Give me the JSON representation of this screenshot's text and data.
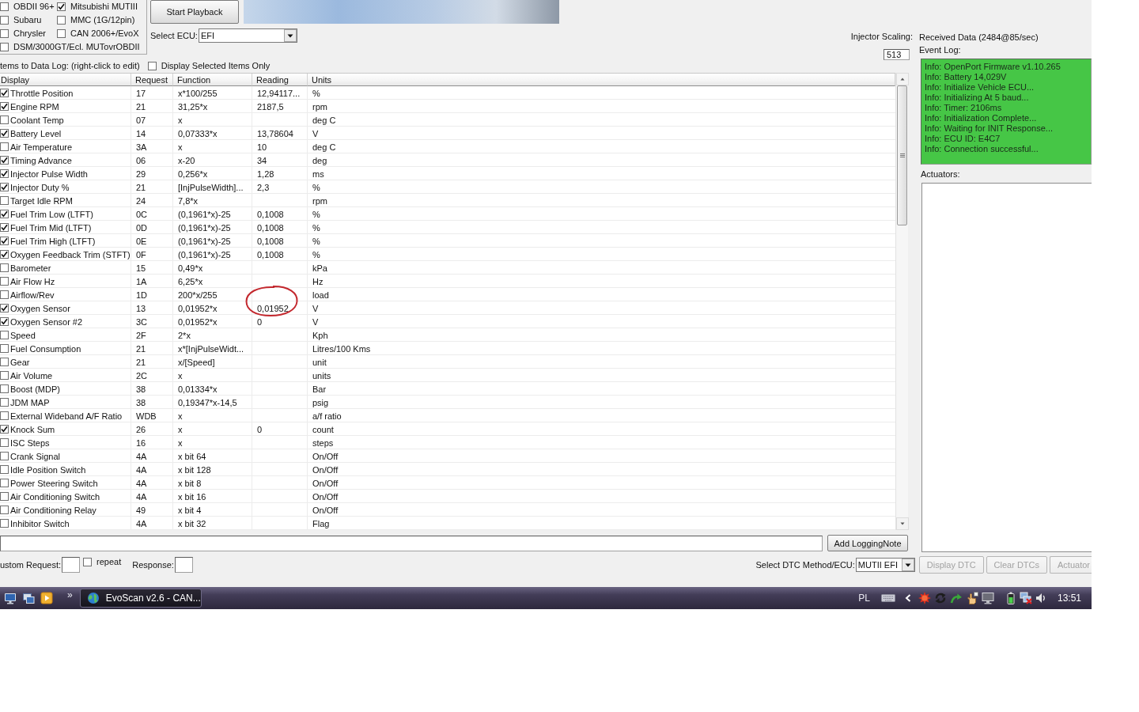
{
  "protocols": [
    {
      "label": "OBDII 96+",
      "checked": false
    },
    {
      "label": "Mitsubishi MUTIII",
      "checked": true
    },
    {
      "label": "Subaru",
      "checked": false
    },
    {
      "label": "MMC (1G/12pin)",
      "checked": false
    },
    {
      "label": "Chrysler",
      "checked": false
    },
    {
      "label": "CAN 2006+/EvoX",
      "checked": false
    },
    {
      "label": "DSM/3000GT/Ecl. MUTovrOBDII",
      "checked": false
    }
  ],
  "playback_button": "Start Playback",
  "ecu_select": {
    "label": "Select ECU:",
    "value": "EFI"
  },
  "injector_scaling": {
    "label": "Injector Scaling:",
    "value": "513"
  },
  "received_data": "Received Data (2484@85/sec)",
  "event_log": {
    "label": "Event Log:",
    "lines": [
      "Info: OpenPort Firmware v1.10.265",
      "Info: Battery 14,029V",
      "Info: Initialize Vehicle ECU...",
      "Info: Initializing At 5 baud...",
      "Info: Timer: 2106ms",
      "Info: Initialization Complete...",
      "Info: Waiting for INIT Response...",
      "Info: ECU ID: E4C7",
      "Info: Connection successful..."
    ]
  },
  "data_log": {
    "label": "tems to Data Log: (right-click to edit)",
    "display_selected_only": {
      "label": "Display Selected Items Only",
      "checked": false
    }
  },
  "table": {
    "columns": [
      "Display",
      "Request",
      "Function",
      "Reading",
      "Units"
    ],
    "rows": [
      {
        "checked": true,
        "display": "Throttle Position",
        "request": "17",
        "function": "x*100/255",
        "reading": "12,94117...",
        "units": "%",
        "circled": false
      },
      {
        "checked": true,
        "display": "Engine RPM",
        "request": "21",
        "function": "31,25*x",
        "reading": "2187,5",
        "units": "rpm",
        "circled": false
      },
      {
        "checked": false,
        "display": "Coolant Temp",
        "request": "07",
        "function": "x",
        "units": "deg C",
        "circled": false
      },
      {
        "checked": true,
        "display": "Battery Level",
        "request": "14",
        "function": "0,07333*x",
        "reading": "13,78604",
        "units": "V",
        "circled": false
      },
      {
        "checked": false,
        "display": "Air Temperature",
        "request": "3A",
        "function": "x",
        "reading": "10",
        "units": "deg C",
        "circled": false
      },
      {
        "checked": true,
        "display": "Timing Advance",
        "request": "06",
        "function": "x-20",
        "reading": "34",
        "units": "deg",
        "circled": false
      },
      {
        "checked": true,
        "display": "Injector Pulse Width",
        "request": "29",
        "function": "0,256*x",
        "reading": "1,28",
        "units": "ms",
        "circled": false
      },
      {
        "checked": true,
        "display": "Injector Duty %",
        "request": "21",
        "function": "[InjPulseWidth]...",
        "reading": "2,3",
        "units": "%",
        "circled": false
      },
      {
        "checked": false,
        "display": "Target Idle RPM",
        "request": "24",
        "function": "7,8*x",
        "units": "rpm",
        "circled": false
      },
      {
        "checked": true,
        "display": "Fuel Trim Low (LTFT)",
        "request": "0C",
        "function": "(0,1961*x)-25",
        "reading": "0,1008",
        "units": "%",
        "circled": false
      },
      {
        "checked": true,
        "display": "Fuel Trim Mid (LTFT)",
        "request": "0D",
        "function": "(0,1961*x)-25",
        "reading": "0,1008",
        "units": "%",
        "circled": false
      },
      {
        "checked": true,
        "display": "Fuel Trim High (LTFT)",
        "request": "0E",
        "function": "(0,1961*x)-25",
        "reading": "0,1008",
        "units": "%",
        "circled": false
      },
      {
        "checked": true,
        "display": "Oxygen Feedback Trim (STFT)",
        "request": "0F",
        "function": "(0,1961*x)-25",
        "reading": "0,1008",
        "units": "%",
        "circled": false
      },
      {
        "checked": false,
        "display": "Barometer",
        "request": "15",
        "function": "0,49*x",
        "units": "kPa",
        "circled": false
      },
      {
        "checked": false,
        "display": "Air Flow Hz",
        "request": "1A",
        "function": "6,25*x",
        "units": "Hz",
        "circled": false
      },
      {
        "checked": false,
        "display": "Airflow/Rev",
        "request": "1D",
        "function": "200*x/255",
        "units": "load",
        "circled": false
      },
      {
        "checked": true,
        "display": "Oxygen Sensor",
        "request": "13",
        "function": "0,01952*x",
        "reading": "0,01952",
        "units": "V",
        "circled": true
      },
      {
        "checked": true,
        "display": "Oxygen Sensor #2",
        "request": "3C",
        "function": "0,01952*x",
        "reading": "0",
        "units": "V",
        "circled": false
      },
      {
        "checked": false,
        "display": "Speed",
        "request": "2F",
        "function": "2*x",
        "units": "Kph",
        "circled": false
      },
      {
        "checked": false,
        "display": "Fuel Consumption",
        "request": "21",
        "function": "x*[InjPulseWidt...",
        "units": "Litres/100 Kms",
        "circled": false
      },
      {
        "checked": false,
        "display": "Gear",
        "request": "21",
        "function": "x/[Speed]",
        "units": "unit",
        "circled": false
      },
      {
        "checked": false,
        "display": "Air Volume",
        "request": "2C",
        "function": "x",
        "units": "units",
        "circled": false
      },
      {
        "checked": false,
        "display": "Boost (MDP)",
        "request": "38",
        "function": "0,01334*x",
        "units": "Bar",
        "circled": false
      },
      {
        "checked": false,
        "display": "JDM MAP",
        "request": "38",
        "function": "0,19347*x-14,5",
        "units": "psig",
        "circled": false
      },
      {
        "checked": false,
        "display": "External Wideband A/F Ratio",
        "request": "WDB",
        "function": "x",
        "units": "a/f ratio",
        "circled": false
      },
      {
        "checked": true,
        "display": "Knock Sum",
        "request": "26",
        "function": "x",
        "reading": "0",
        "units": "count",
        "circled": false
      },
      {
        "checked": false,
        "display": "ISC Steps",
        "request": "16",
        "function": "x",
        "units": "steps",
        "circled": false
      },
      {
        "checked": false,
        "display": "Crank Signal",
        "request": "4A",
        "function": "x bit 64",
        "units": "On/Off",
        "circled": false
      },
      {
        "checked": false,
        "display": "Idle Position Switch",
        "request": "4A",
        "function": "x bit 128",
        "units": "On/Off",
        "circled": false
      },
      {
        "checked": false,
        "display": "Power Steering Switch",
        "request": "4A",
        "function": "x bit 8",
        "units": "On/Off",
        "circled": false
      },
      {
        "checked": false,
        "display": "Air Conditioning Switch",
        "request": "4A",
        "function": "x bit 16",
        "units": "On/Off",
        "circled": false
      },
      {
        "checked": false,
        "display": "Air Conditioning Relay",
        "request": "49",
        "function": "x bit 4",
        "units": "On/Off",
        "circled": false
      },
      {
        "checked": false,
        "display": "Inhibitor Switch",
        "request": "4A",
        "function": "x bit 32",
        "units": "Flag",
        "circled": false
      }
    ]
  },
  "actuators": {
    "label": "Actuators:"
  },
  "logging_note": {
    "button": "Add LoggingNote"
  },
  "custom_request": {
    "label": "ustom Request:",
    "repeat": {
      "label": "repeat",
      "checked": false
    }
  },
  "response": {
    "label": "Response:"
  },
  "dtc": {
    "label": "Select DTC Method/ECU:",
    "value": "MUTII EFI",
    "buttons": [
      {
        "label": "Display DTC",
        "disabled": true
      },
      {
        "label": "Clear DTCs",
        "disabled": true
      },
      {
        "label": "Actuator",
        "disabled": true
      }
    ]
  },
  "taskbar": {
    "more": "»",
    "window_button": "EvoScan v2.6 - CAN...",
    "language": "PL",
    "clock": "13:51"
  }
}
